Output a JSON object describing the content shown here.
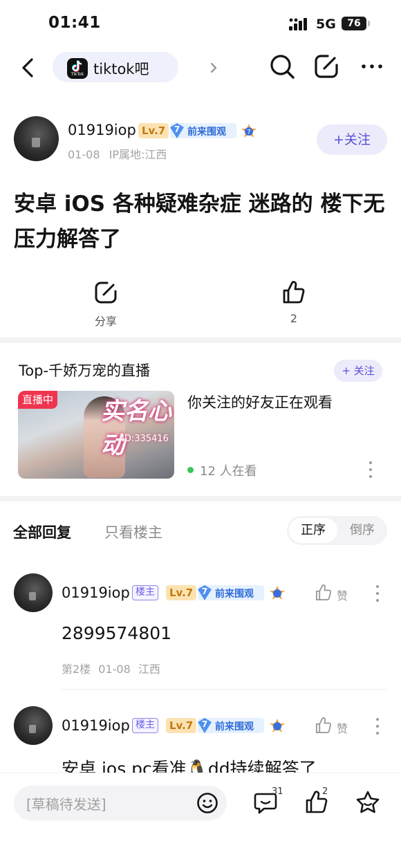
{
  "status_bar": {
    "time": "01:41",
    "network": "5G",
    "battery": "76"
  },
  "nav": {
    "forum_name": "tiktok吧",
    "logo_text": "TikTok"
  },
  "post": {
    "author": {
      "name": "01919iop",
      "level": "Lv.7",
      "fan_level": "7",
      "fan_badge": "前来围观",
      "medal_level": "7",
      "date": "01-08",
      "ip": "IP属地:江西"
    },
    "follow_label": "+关注",
    "title": "安卓 iOS 各种疑难杂症 迷路的 楼下无压力解答了",
    "share_label": "分享",
    "like_count": "2"
  },
  "live": {
    "title": "Top-千娇万宠的直播",
    "follow_label": "+ 关注",
    "tag": "直播中",
    "thumb_text": "实名心动",
    "thumb_id": "ID:335416",
    "description": "你关注的好友正在观看",
    "watching": "12 人在看"
  },
  "replies_header": {
    "tab_all": "全部回复",
    "tab_owner": "只看楼主",
    "sort_asc": "正序",
    "sort_desc": "倒序"
  },
  "replies": [
    {
      "name": "01919iop",
      "owner_tag": "楼主",
      "level": "Lv.7",
      "fan_level": "7",
      "fan_badge": "前来围观",
      "like_label": "赞",
      "content": "2899574801",
      "meta": "第2楼 01-08 江西"
    },
    {
      "name": "01919iop",
      "owner_tag": "楼主",
      "level": "Lv.7",
      "fan_level": "7",
      "fan_badge": "前来围观",
      "like_label": "赞",
      "content": "安卓 ios pc看准🐧dd持续解答了"
    }
  ],
  "bottom_bar": {
    "draft_placeholder": "[草稿待发送]",
    "comment_count": "31",
    "like_count": "2"
  },
  "colors": {
    "accent": "#5a4fd6",
    "live_red": "#f0344e",
    "online_green": "#39c75a"
  }
}
